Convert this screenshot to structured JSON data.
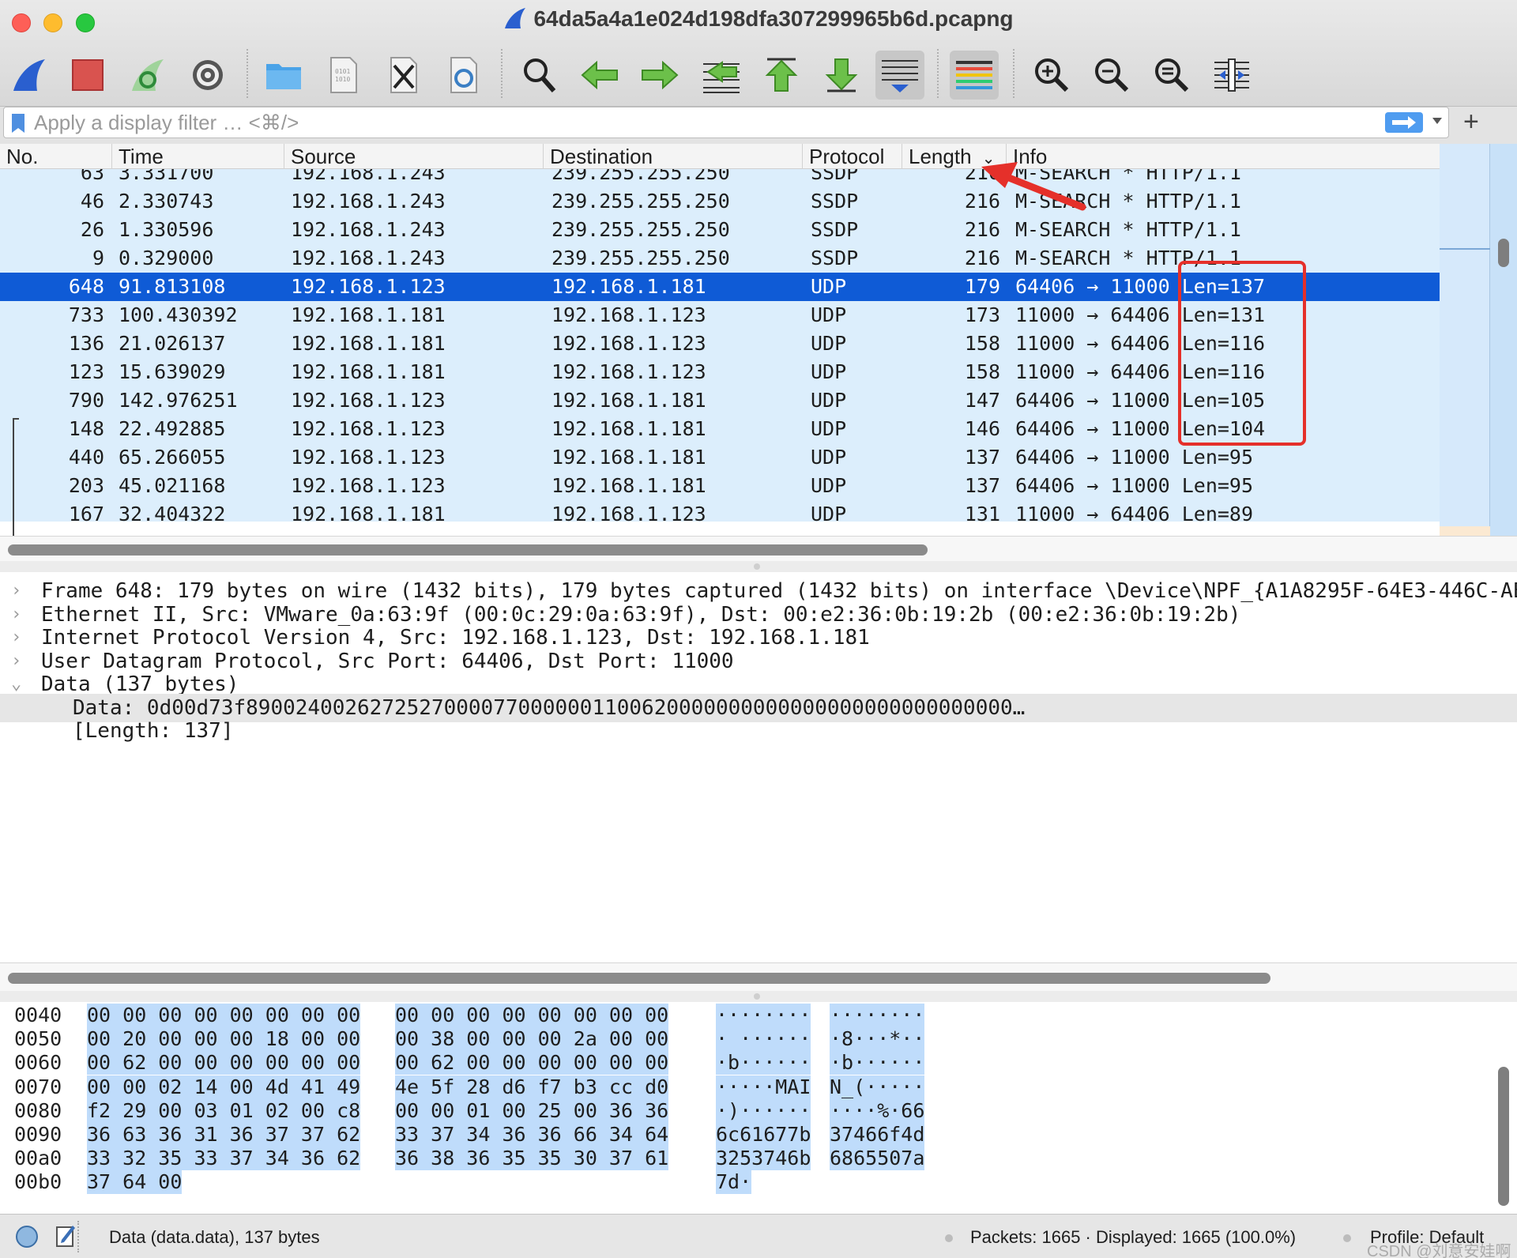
{
  "window": {
    "title": "64da5a4a1e024d198dfa307299965b6d.pcapng"
  },
  "toolbar": {
    "buttons": [
      {
        "icon": "shark-fin-icon",
        "label": "Start capture"
      },
      {
        "icon": "stop-icon",
        "label": "Stop capture"
      },
      {
        "icon": "restart-icon",
        "label": "Restart capture"
      },
      {
        "icon": "gear-icon",
        "label": "Capture options"
      },
      {
        "icon": "folder-icon",
        "label": "Open"
      },
      {
        "icon": "binary-file-icon",
        "label": "Save"
      },
      {
        "icon": "close-file-icon",
        "label": "Close"
      },
      {
        "icon": "reload-icon",
        "label": "Reload"
      },
      {
        "icon": "search-icon",
        "label": "Find packet"
      },
      {
        "icon": "back-icon",
        "label": "Go back"
      },
      {
        "icon": "forward-icon",
        "label": "Go forward"
      },
      {
        "icon": "goto-icon",
        "label": "Go to packet"
      },
      {
        "icon": "first-icon",
        "label": "First packet"
      },
      {
        "icon": "last-icon",
        "label": "Last packet"
      },
      {
        "icon": "autoscroll-icon",
        "label": "Auto scroll"
      },
      {
        "icon": "colorize-icon",
        "label": "Colorize"
      },
      {
        "icon": "zoom-in-icon",
        "label": "Zoom in"
      },
      {
        "icon": "zoom-out-icon",
        "label": "Zoom out"
      },
      {
        "icon": "zoom-reset-icon",
        "label": "Normal size"
      },
      {
        "icon": "resize-columns-icon",
        "label": "Resize columns"
      }
    ]
  },
  "filter": {
    "placeholder": "Apply a display filter … <⌘/>",
    "value": "",
    "add_label": "+"
  },
  "packet_list": {
    "columns": [
      "No.",
      "Time",
      "Source",
      "Destination",
      "Protocol",
      "Length",
      "Info"
    ],
    "sort_indicator": "⌄",
    "rows": [
      {
        "no": "63",
        "time": "3.331700",
        "src": "192.168.1.243",
        "dst": "239.255.255.250",
        "proto": "SSDP",
        "len": "216",
        "info": "M-SEARCH * HTTP/1.1"
      },
      {
        "no": "46",
        "time": "2.330743",
        "src": "192.168.1.243",
        "dst": "239.255.255.250",
        "proto": "SSDP",
        "len": "216",
        "info": "M-SEARCH * HTTP/1.1"
      },
      {
        "no": "26",
        "time": "1.330596",
        "src": "192.168.1.243",
        "dst": "239.255.255.250",
        "proto": "SSDP",
        "len": "216",
        "info": "M-SEARCH * HTTP/1.1"
      },
      {
        "no": "9",
        "time": "0.329000",
        "src": "192.168.1.243",
        "dst": "239.255.255.250",
        "proto": "SSDP",
        "len": "216",
        "info": "M-SEARCH * HTTP/1.1"
      },
      {
        "no": "648",
        "time": "91.813108",
        "src": "192.168.1.123",
        "dst": "192.168.1.181",
        "proto": "UDP",
        "len": "179",
        "info": "64406 → 11000 Len=137",
        "selected": true
      },
      {
        "no": "733",
        "time": "100.430392",
        "src": "192.168.1.181",
        "dst": "192.168.1.123",
        "proto": "UDP",
        "len": "173",
        "info": "11000 → 64406 Len=131"
      },
      {
        "no": "136",
        "time": "21.026137",
        "src": "192.168.1.181",
        "dst": "192.168.1.123",
        "proto": "UDP",
        "len": "158",
        "info": "11000 → 64406 Len=116"
      },
      {
        "no": "123",
        "time": "15.639029",
        "src": "192.168.1.181",
        "dst": "192.168.1.123",
        "proto": "UDP",
        "len": "158",
        "info": "11000 → 64406 Len=116"
      },
      {
        "no": "790",
        "time": "142.976251",
        "src": "192.168.1.123",
        "dst": "192.168.1.181",
        "proto": "UDP",
        "len": "147",
        "info": "64406 → 11000 Len=105"
      },
      {
        "no": "148",
        "time": "22.492885",
        "src": "192.168.1.123",
        "dst": "192.168.1.181",
        "proto": "UDP",
        "len": "146",
        "info": "64406 → 11000 Len=104"
      },
      {
        "no": "440",
        "time": "65.266055",
        "src": "192.168.1.123",
        "dst": "192.168.1.181",
        "proto": "UDP",
        "len": "137",
        "info": "64406 → 11000 Len=95"
      },
      {
        "no": "203",
        "time": "45.021168",
        "src": "192.168.1.123",
        "dst": "192.168.1.181",
        "proto": "UDP",
        "len": "137",
        "info": "64406 → 11000 Len=95"
      },
      {
        "no": "167",
        "time": "32.404322",
        "src": "192.168.1.181",
        "dst": "192.168.1.123",
        "proto": "UDP",
        "len": "131",
        "info": "11000 → 64406 Len=89"
      }
    ]
  },
  "details": {
    "rows": [
      {
        "arrow": "›",
        "text": "Frame 648: 179 bytes on wire (1432 bits), 179 bytes captured (1432 bits) on interface \\Device\\NPF_{A1A8295F-64E3-446C-AE"
      },
      {
        "arrow": "›",
        "text": "Ethernet II, Src: VMware_0a:63:9f (00:0c:29:0a:63:9f), Dst: 00:e2:36:0b:19:2b (00:e2:36:0b:19:2b)"
      },
      {
        "arrow": "›",
        "text": "Internet Protocol Version 4, Src: 192.168.1.123, Dst: 192.168.1.181"
      },
      {
        "arrow": "›",
        "text": "User Datagram Protocol, Src Port: 64406, Dst Port: 11000"
      },
      {
        "arrow": "⌄",
        "text": "Data (137 bytes)"
      }
    ],
    "children": [
      {
        "text": "Data: 0d00d73f89002400262725270000770000001100620000000000000000000000000000…",
        "highlighted": true
      },
      {
        "text": "[Length: 137]",
        "highlighted": false
      }
    ]
  },
  "bytes": {
    "rows": [
      {
        "offset": "0040",
        "hex1": "00 00 00 00 00 00 00 00",
        "hex2": "00 00 00 00 00 00 00 00",
        "asc1": "········",
        "asc2": "········"
      },
      {
        "offset": "0050",
        "hex1": "00 20 00 00 00 18 00 00",
        "hex2": "00 38 00 00 00 2a 00 00",
        "asc1": "· ······",
        "asc2": "·8···*··"
      },
      {
        "offset": "0060",
        "hex1": "00 62 00 00 00 00 00 00",
        "hex2": "00 62 00 00 00 00 00 00",
        "asc1": "·b······",
        "asc2": "·b······"
      },
      {
        "offset": "0070",
        "hex1": "00 00 02 14 00 4d 41 49",
        "hex2": "4e 5f 28 d6 f7 b3 cc d0",
        "asc1": "·····MAI",
        "asc2": "N_(·····"
      },
      {
        "offset": "0080",
        "hex1": "f2 29 00 03 01 02 00 c8",
        "hex2": "00 00 01 00 25 00 36 36",
        "asc1": "·)······",
        "asc2": "····%·66"
      },
      {
        "offset": "0090",
        "hex1": "36 63 36 31 36 37 37 62",
        "hex2": "33 37 34 36 36 66 34 64",
        "asc1": "6c61677b",
        "asc2": "37466f4d"
      },
      {
        "offset": "00a0",
        "hex1": "33 32 35 33 37 34 36 62",
        "hex2": "36 38 36 35 35 30 37 61",
        "asc1": "3253746b",
        "asc2": "6865507a"
      },
      {
        "offset": "00b0",
        "hex1": "37 64 00",
        "hex2": "",
        "asc1": "7d·",
        "asc2": ""
      }
    ]
  },
  "status": {
    "field": "Data (data.data), 137 bytes",
    "packets": "Packets: 1665 · Displayed: 1665 (100.0%)",
    "profile": "Profile: Default",
    "watermark": "CSDN @刘意安娃啊"
  },
  "colors": {
    "row_bg": "#dceefc",
    "row_selected": "#0f5bd6",
    "annotation_red": "#e5302a",
    "hex_highlight": "#bfdcfb"
  }
}
